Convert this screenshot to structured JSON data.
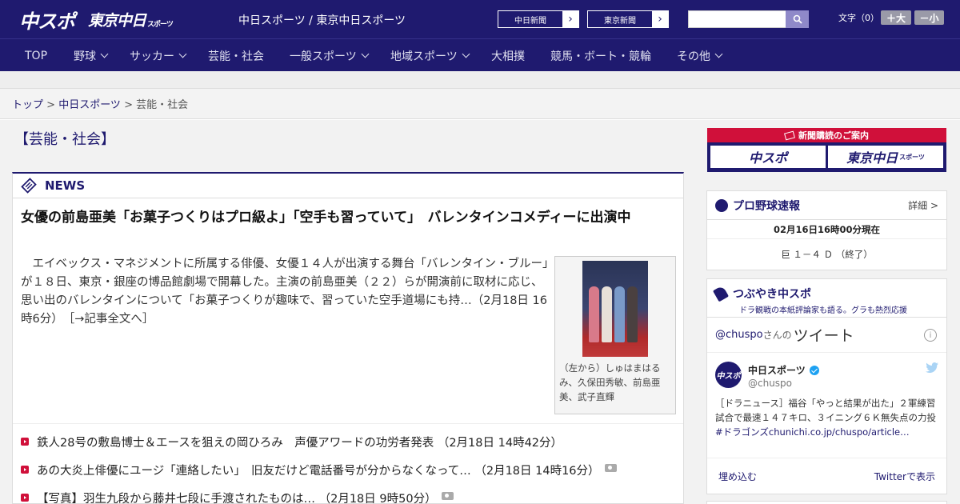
{
  "header": {
    "logo_chuspo": "中スポ",
    "logo_tokyo": "東京中日",
    "logo_tokyo_small": "スポーツ",
    "site_names": "中日スポーツ / 東京中日スポーツ",
    "btn_chunichi": "中日新聞",
    "btn_tokyo": "東京新聞",
    "arrow": "›",
    "search_placeholder": "",
    "fontsize_label": "文字（0）",
    "font_big": "＋大",
    "font_small": "－小"
  },
  "nav": {
    "items": [
      {
        "label": "TOP"
      },
      {
        "label": "野球"
      },
      {
        "label": "サッカー"
      },
      {
        "label": "芸能・社会"
      },
      {
        "label": "一般スポーツ"
      },
      {
        "label": "地域スポーツ"
      },
      {
        "label": "大相撲"
      },
      {
        "label": "競馬・ボート・競輪"
      },
      {
        "label": "その他"
      }
    ]
  },
  "breadcrumb": {
    "top": "トップ",
    "sep": " > ",
    "chunichi": "中日スポーツ",
    "current": "芸能・社会"
  },
  "section_title": "【芸能・社会】",
  "news": {
    "label": "NEWS",
    "headline": "女優の前島亜美「お菓子つくりはプロ級よ」「空手も習っていて」　バレンタインコメディーに出演中",
    "body": "エイベックス・マネジメントに所属する俳優、女優１４人が出演する舞台「バレンタイン・ブルー」が１８日、東京・銀座の博品館劇場で開幕した。主演の前島亜美（２２）らが開演前に取材に応じ、思い出のバレンタインについて「お菓子つくりが趣味で、習っていた空手道場にも持…（2月18日 16時6分）",
    "read_more": "［→記事全文へ］",
    "photo_caption": "（左から）しゅはまはるみ、久保田秀敏、前島亜美、武子直輝",
    "list": [
      {
        "text": "鉄人28号の敷島博士＆エースを狙えの岡ひろみ　声優アワードの功労者発表 （2月18日 14時42分）",
        "camera": false
      },
      {
        "text": "あの大炎上俳優にユージ「連絡したい」　旧友だけど電話番号が分からなくなって… （2月18日 14時16分）",
        "camera": true
      },
      {
        "text": "【写真】羽生九段から藤井七段に手渡されたものは… （2月18日 9時50分）",
        "camera": true
      }
    ]
  },
  "sidebar": {
    "subscribe": {
      "title": "新聞購読のご案内",
      "chuspo": "中スポ",
      "tokyo": "東京中日",
      "tokyo_small": "スポーツ"
    },
    "baseball": {
      "title": "プロ野球速報",
      "more": "詳細 >",
      "date": "02月16日16時00分現在",
      "score": "巨 １－４ Ｄ （終了）"
    },
    "tweets": {
      "title": "つぶやき中スポ",
      "subtitle": "ドラ観戦の本紙評論家も語る。グラも熱烈応援",
      "user": "@chuspo",
      "san": "さんの",
      "big": "ツイート",
      "info": "i",
      "avatar_text": "中スポ",
      "name": "中日スポーツ",
      "handle": "@chuspo",
      "bird": "🐦",
      "text_plain": "［ドラニュース］福谷「やっと結果が出た」２軍練習試合で最速１４７キロ、３イニング６Ｋ無失点の力投",
      "text_link": "#ドラゴンズchunichi.co.jp/chuspo/article…",
      "embed": "埋め込む",
      "view": "Twitterで表示"
    }
  }
}
